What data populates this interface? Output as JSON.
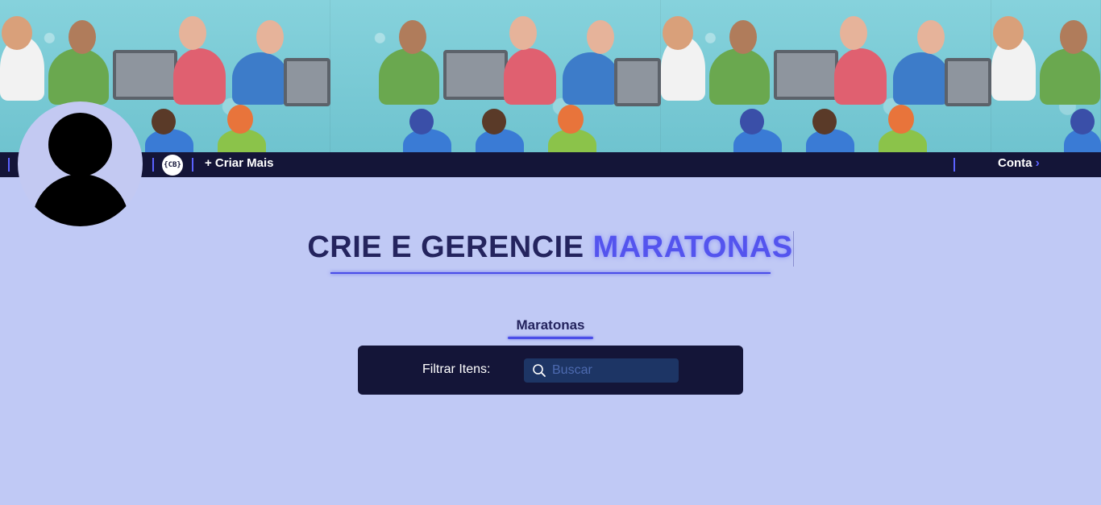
{
  "navbar": {
    "logo_text": "{CB}",
    "create_more_label": "+ Criar Mais",
    "account_label": "Conta",
    "account_chevron": "›"
  },
  "hero": {
    "title_part1": "CRIE E GERENCIE ",
    "title_part2": "MARATONAS"
  },
  "section": {
    "title": "Maratonas"
  },
  "filter": {
    "label": "Filtrar Itens:",
    "search_placeholder": "Buscar",
    "search_value": ""
  },
  "colors": {
    "navbar_bg": "#141538",
    "accent": "#5b62ff",
    "page_bg": "#c0c9f5",
    "title_dark": "#24245e",
    "title_accent": "#5454ee",
    "search_bg": "#1d3565"
  },
  "icons": {
    "avatar": "user-silhouette-icon",
    "search": "search-icon",
    "chevron": "chevron-right-icon"
  }
}
